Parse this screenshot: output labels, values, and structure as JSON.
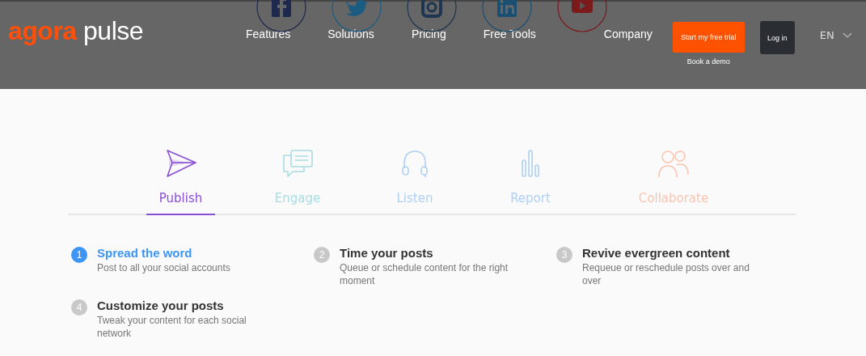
{
  "header": {
    "logo": {
      "brand": "agora",
      "product": "pulse"
    },
    "social_icons": [
      {
        "kind": "facebook",
        "color": "#1d2a4d"
      },
      {
        "kind": "twitter",
        "color": "#1b5d82"
      },
      {
        "kind": "instagram",
        "color": "#1d3550"
      },
      {
        "kind": "linkedin",
        "color": "#1b4f72"
      },
      {
        "kind": "youtube",
        "color": "#7a1a1a"
      }
    ],
    "nav": [
      "Features",
      "Solutions",
      "Pricing",
      "Free Tools",
      "Company"
    ],
    "trial_button": "Start my free trial",
    "demo_link": "Book a demo",
    "login_button": "Log in",
    "language": "EN"
  },
  "tabs": [
    {
      "label": "Publish",
      "kind": "plane",
      "color": "#8a4fd6",
      "selected": true
    },
    {
      "label": "Engage",
      "kind": "chat",
      "color": "#a8dde0",
      "selected": false
    },
    {
      "label": "Listen",
      "kind": "headphones",
      "color": "#aed0f5",
      "selected": false
    },
    {
      "label": "Report",
      "kind": "bars",
      "color": "#aed0f5",
      "selected": false
    },
    {
      "label": "Collaborate",
      "kind": "people",
      "color": "#f9c4b0",
      "selected": false
    }
  ],
  "steps": [
    {
      "number": "1",
      "title": "Spread the word",
      "description": "Post to all your social accounts",
      "selected": true
    },
    {
      "number": "2",
      "title": "Time your posts",
      "description": "Queue or schedule content for the right moment",
      "selected": false
    },
    {
      "number": "3",
      "title": "Revive evergreen content",
      "description": "Requeue or reschedule posts over and over",
      "selected": false
    },
    {
      "number": "4",
      "title": "Customize your posts",
      "description": "Tweak your content for each social network",
      "selected": false
    }
  ]
}
